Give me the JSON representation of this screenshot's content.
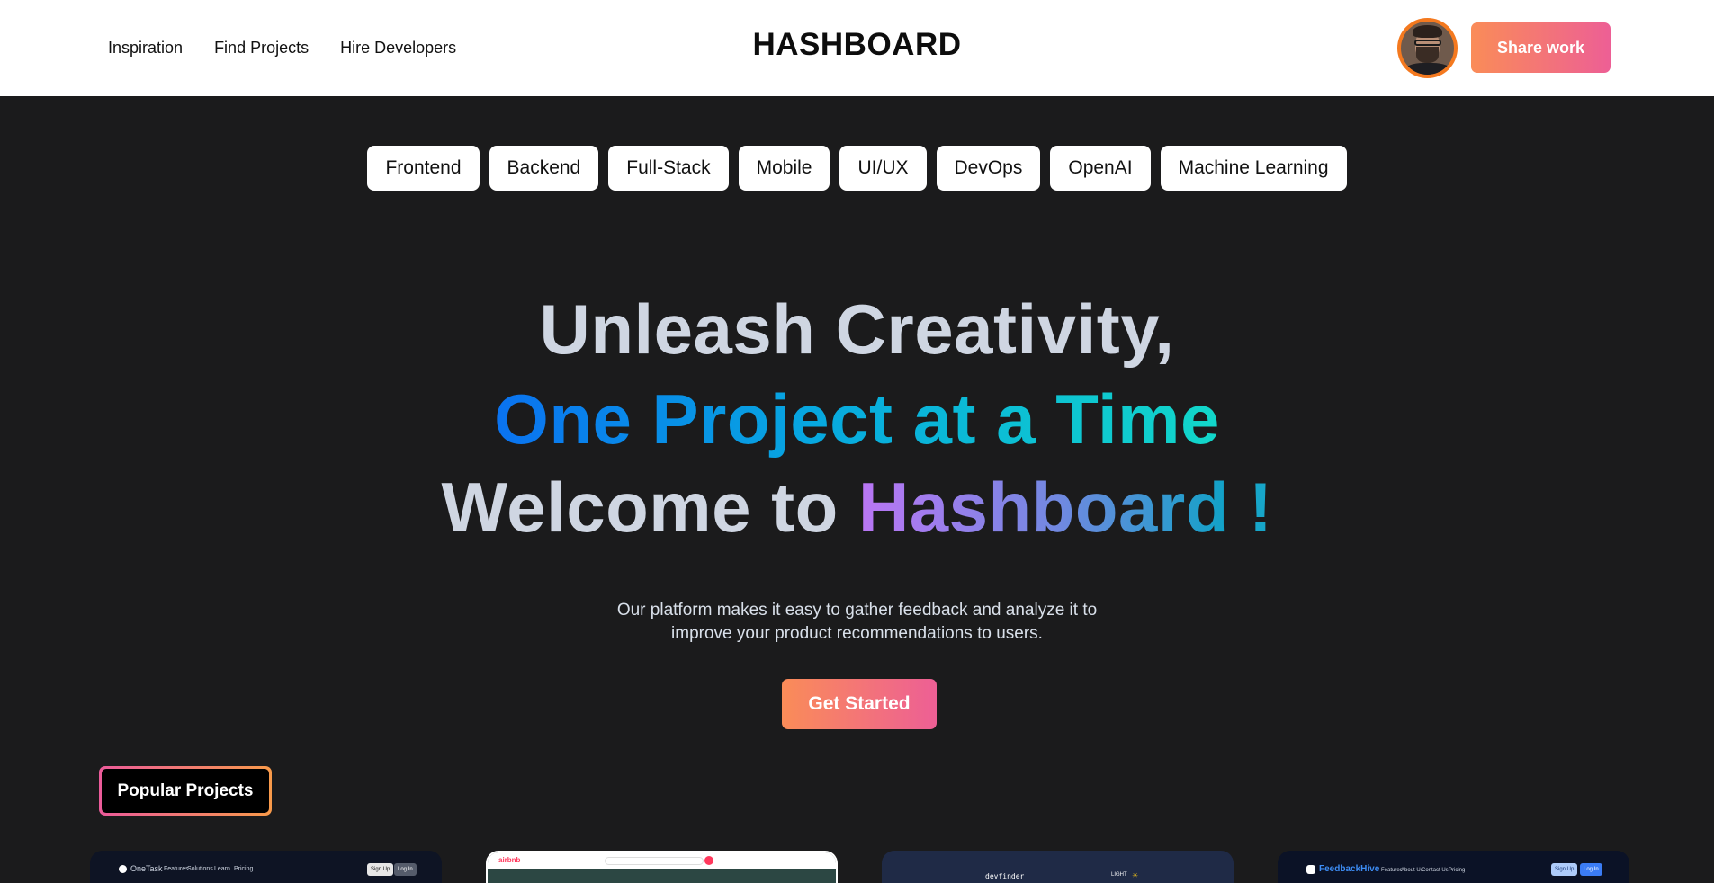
{
  "header": {
    "nav": [
      "Inspiration",
      "Find Projects",
      "Hire Developers"
    ],
    "logo": "HASHBOARD",
    "share_label": "Share work"
  },
  "categories": [
    "Frontend",
    "Backend",
    "Full-Stack",
    "Mobile",
    "UI/UX",
    "DevOps",
    "OpenAI",
    "Machine Learning"
  ],
  "hero": {
    "line1": "Unleash Creativity,",
    "line2": "One Project at a Time",
    "line3_prefix": "Welcome to",
    "line3_brand": "Hashboard",
    "line3_suffix": "!",
    "subtitle_1": "Our platform makes it easy to gather feedback and analyze it to",
    "subtitle_2": "improve your product recommendations to users.",
    "cta_label": "Get Started"
  },
  "popular": {
    "label": "Popular Projects"
  },
  "projects": [
    {
      "name": "OneTask",
      "nav": [
        "Features",
        "Solutions",
        "Learn",
        "Pricing"
      ],
      "buttons": [
        "Sign Up",
        "Log In"
      ]
    },
    {
      "name": "airbnb"
    },
    {
      "name": "devfinder",
      "toggle": "LIGHT"
    },
    {
      "name": "FeedbackHive",
      "nav": [
        "Features",
        "About Us",
        "Contact Us",
        "Pricing"
      ],
      "buttons": [
        "Sign Up",
        "Log In"
      ]
    }
  ],
  "colors": {
    "accent_start": "#fa8c58",
    "accent_end": "#ed5f95",
    "background": "#1b1b1c"
  }
}
